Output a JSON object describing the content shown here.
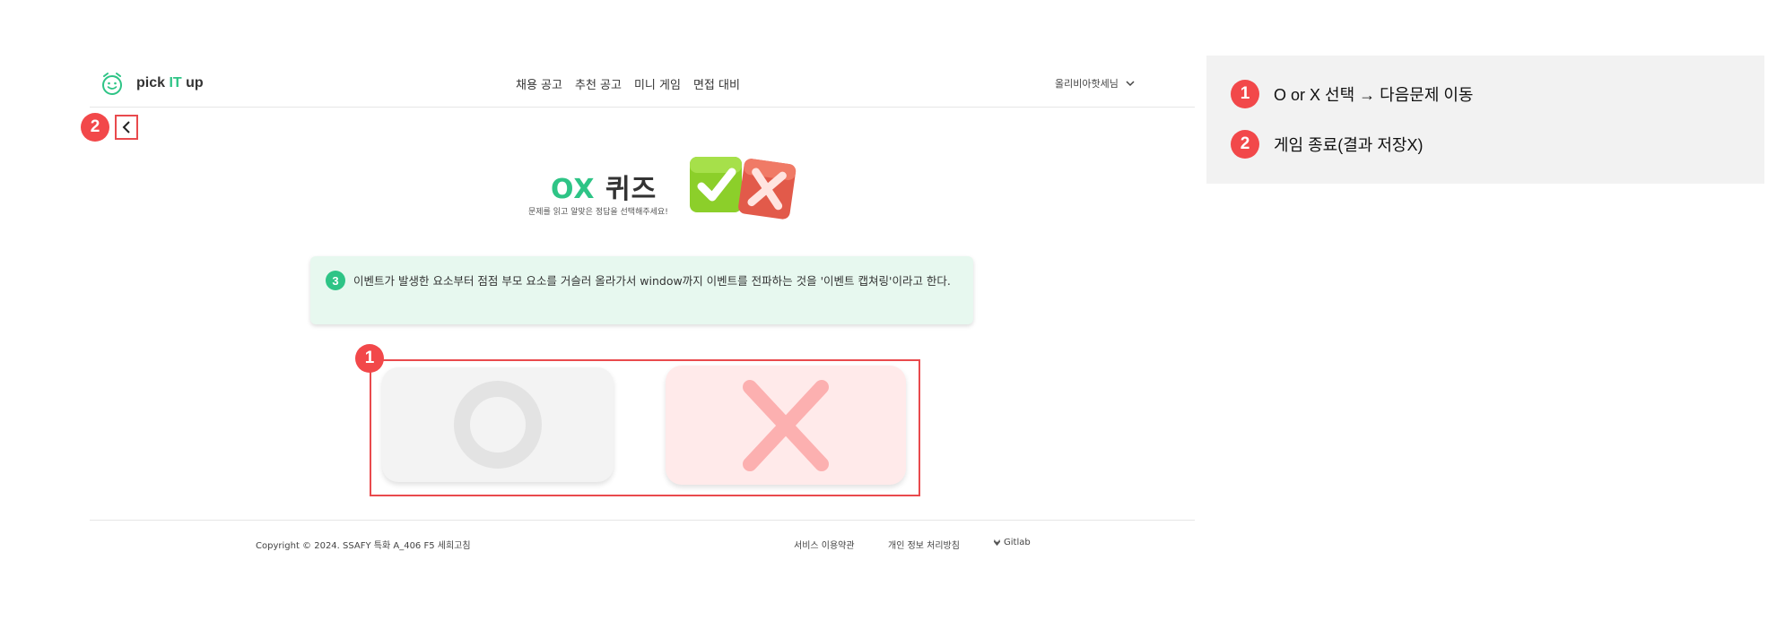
{
  "header": {
    "logo_text_1": "pick ",
    "logo_text_it": "IT",
    "logo_text_2": " up",
    "nav": [
      "채용 공고",
      "추천 공고",
      "미니 게임",
      "면접 대비"
    ],
    "user_name": "올리비아핫세님"
  },
  "badges": {
    "one": "1",
    "two": "2",
    "three": "3"
  },
  "quiz": {
    "title_ox": "OX",
    "title_rest": " 퀴즈",
    "subtitle": "문제를 읽고 알맞은 정답을 선택해주세요!",
    "question": "이벤트가 발생한 요소부터 점점 부모 요소를 거슬러 올라가서 window까지 이벤트를 전파하는 것을 '이벤트 캡쳐링'이라고 한다."
  },
  "footer": {
    "copyright": "Copyright © 2024. SSAFY 특화 A_406 F5 세희고침",
    "links": [
      "서비스 이용약관",
      "개인 정보 처리방침",
      "Gitlab"
    ]
  },
  "annotations": [
    {
      "num": "1",
      "text": "O or X 선택 → 다음문제 이동"
    },
    {
      "num": "2",
      "text": "게임 종료(결과 저장X)"
    }
  ],
  "colors": {
    "brand_green": "#2ec486",
    "annotation_red": "#f2484a",
    "question_bg": "#e7f8ef"
  }
}
